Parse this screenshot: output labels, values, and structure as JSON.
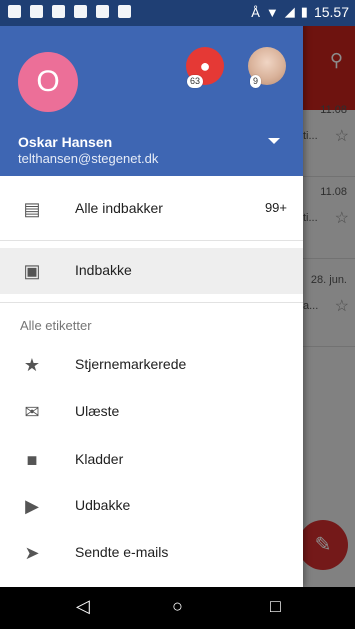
{
  "statusbar": {
    "time": "15.57"
  },
  "background": {
    "rows": [
      {
        "date": "11.08",
        "snippet": "ti..."
      },
      {
        "date": "11.08",
        "snippet": "ti..."
      },
      {
        "date": "28. jun.",
        "snippet": "a..."
      }
    ]
  },
  "drawer": {
    "avatar_letter": "O",
    "account_badges": [
      "63",
      "9"
    ],
    "account_name": "Oskar Hansen",
    "account_email": "telthansen@stegenet.dk",
    "items": [
      {
        "label": "Alle indbakker",
        "count": "99+"
      },
      {
        "label": "Indbakke"
      }
    ],
    "section_title": "Alle etiketter",
    "labels": [
      {
        "label": "Stjernemarkerede"
      },
      {
        "label": "Ulæste"
      },
      {
        "label": "Kladder"
      },
      {
        "label": "Udbakke"
      },
      {
        "label": "Sendte e-mails"
      }
    ]
  },
  "colors": {
    "header": "#3e66b3",
    "accent_avatar": "#ec6f98",
    "toolbar_bg": "#c9231c"
  }
}
